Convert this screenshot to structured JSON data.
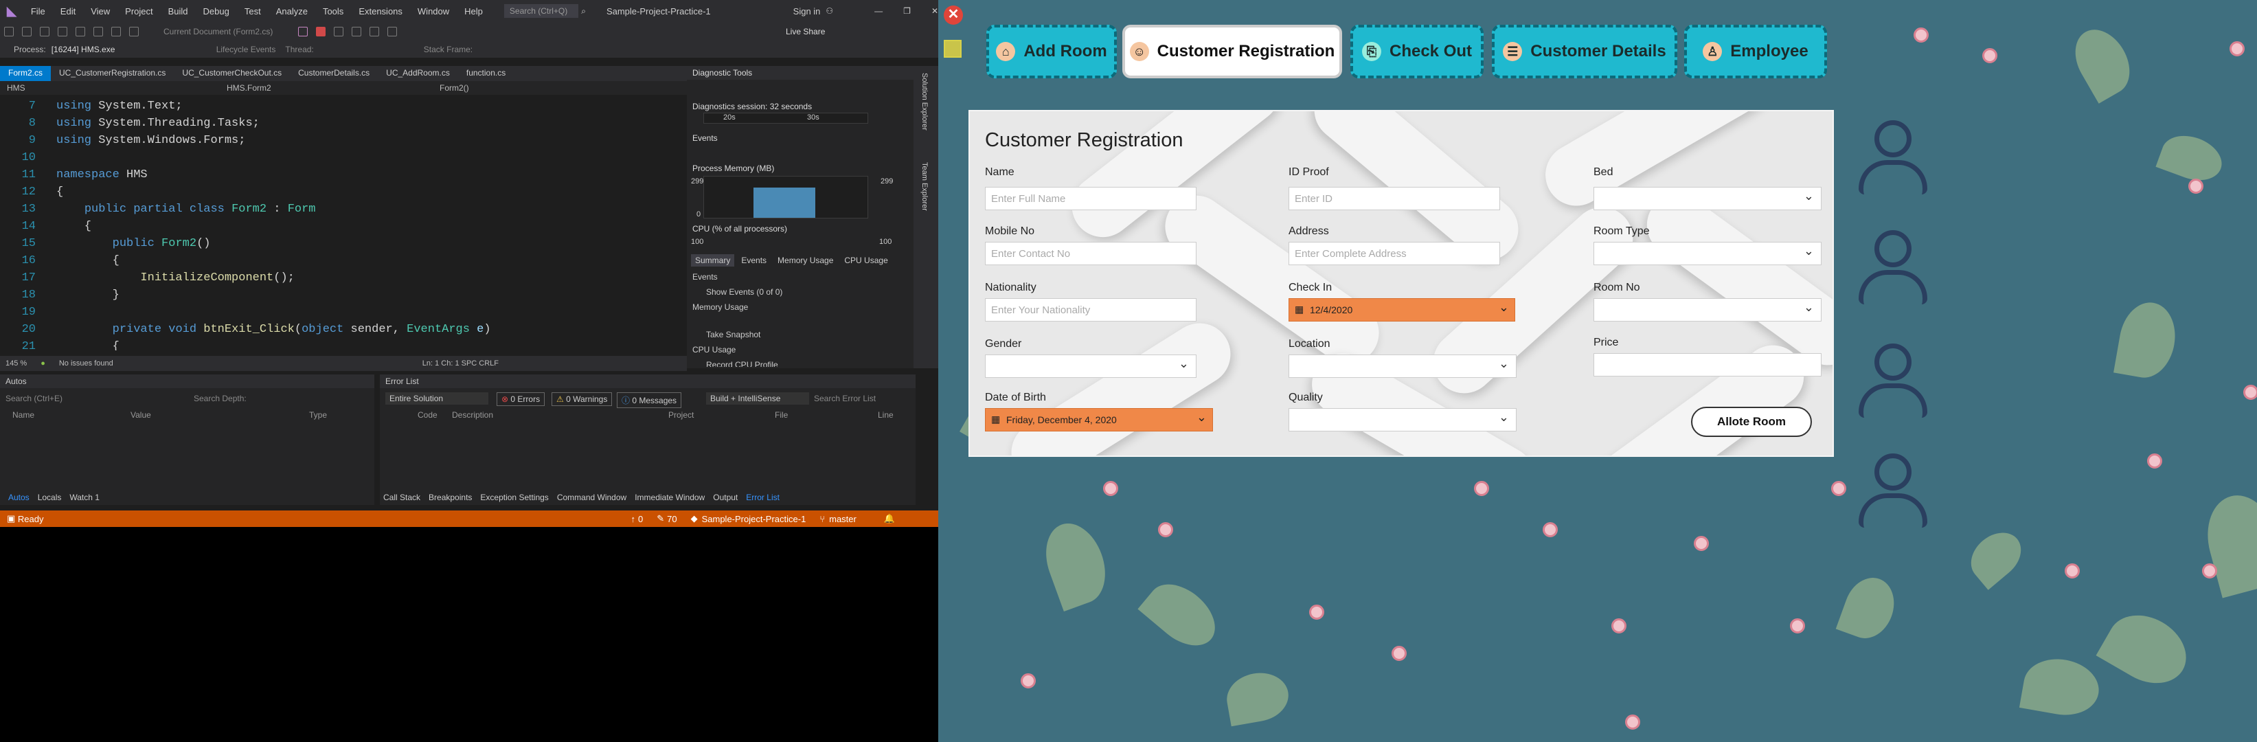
{
  "vs": {
    "menu": [
      "File",
      "Edit",
      "View",
      "Project",
      "Build",
      "Debug",
      "Test",
      "Analyze",
      "Tools",
      "Extensions",
      "Window",
      "Help"
    ],
    "search_placeholder": "Search (Ctrl+Q)",
    "solution_title": "Sample-Project-Practice-1",
    "sign_in": "Sign in",
    "live_share": "Live Share",
    "current_doc": "Current Document (Form2.cs)",
    "process_label": "Process:",
    "process_value": "[16244] HMS.exe",
    "lifecycle": "Lifecycle Events",
    "thread": "Thread:",
    "stack_frame": "Stack Frame:",
    "tabs": [
      "Form2.cs",
      "UC_CustomerRegistration.cs",
      "UC_CustomerCheckOut.cs",
      "CustomerDetails.cs",
      "UC_AddRoom.cs",
      "function.cs"
    ],
    "nav": {
      "project": "HMS",
      "class": "HMS.Form2",
      "member": "Form2()"
    },
    "code_lines": [
      {
        "n": "7",
        "t": "using System.Text;"
      },
      {
        "n": "8",
        "t": "using System.Threading.Tasks;"
      },
      {
        "n": "9",
        "t": "using System.Windows.Forms;"
      },
      {
        "n": "10",
        "t": ""
      },
      {
        "n": "11",
        "t": "namespace HMS"
      },
      {
        "n": "12",
        "t": "{"
      },
      {
        "n": "13",
        "t": "    public partial class Form2 : Form"
      },
      {
        "n": "14",
        "t": "    {"
      },
      {
        "n": "15",
        "t": "        public Form2()"
      },
      {
        "n": "16",
        "t": "        {"
      },
      {
        "n": "17",
        "t": "            InitializeComponent();"
      },
      {
        "n": "18",
        "t": "        }"
      },
      {
        "n": "19",
        "t": ""
      },
      {
        "n": "20",
        "t": "        private void btnExit_Click(object sender, EventArgs e)"
      },
      {
        "n": "21",
        "t": "        {"
      }
    ],
    "zoom": "145 %",
    "issues": "No issues found",
    "ln_col": "Ln: 1   Ch: 1   SPC   CRLF",
    "diag": {
      "title": "Diagnostic Tools",
      "session": "Diagnostics session: 32 seconds",
      "t20": "20s",
      "t30": "30s",
      "events": "Events",
      "memory": "Process Memory (MB)",
      "mem_max": "299",
      "mem_min": "0",
      "cpu": "CPU (% of all processors)",
      "cpu_max": "100",
      "tabs": [
        "Summary",
        "Events",
        "Memory Usage",
        "CPU Usage"
      ],
      "ev_head": "Events",
      "show_events": "Show Events (0 of 0)",
      "mem_head": "Memory Usage",
      "take_snapshot": "Take Snapshot",
      "cpu_head": "CPU Usage",
      "record_cpu": "Record CPU Profile"
    },
    "autos": {
      "title": "Autos",
      "search": "Search (Ctrl+E)",
      "depth": "Search Depth:",
      "cols": [
        "Name",
        "Value",
        "Type"
      ]
    },
    "errors": {
      "title": "Error List",
      "scope": "Entire Solution",
      "err": "0 Errors",
      "warn": "0 Warnings",
      "msg": "0 Messages",
      "build": "Build + IntelliSense",
      "search": "Search Error List",
      "cols": [
        "Code",
        "Description",
        "Project",
        "File",
        "Line"
      ]
    },
    "bottom_left_tabs": [
      "Autos",
      "Locals",
      "Watch 1"
    ],
    "bottom_right_tabs": [
      "Call Stack",
      "Breakpoints",
      "Exception Settings",
      "Command Window",
      "Immediate Window",
      "Output",
      "Error List"
    ],
    "status": {
      "ready": "Ready",
      "up": "0",
      "edits": "70",
      "project": "Sample-Project-Practice-1",
      "branch": "master"
    },
    "side_tabs": [
      "Solution Explorer",
      "Team Explorer"
    ]
  },
  "app": {
    "nav": [
      {
        "label": "Add Room",
        "icon": "room-icon"
      },
      {
        "label": "Customer Registration",
        "icon": "customer-icon"
      },
      {
        "label": "Check Out",
        "icon": "checkout-icon"
      },
      {
        "label": "Customer Details",
        "icon": "details-icon"
      },
      {
        "label": "Employee",
        "icon": "employee-icon"
      }
    ],
    "heading": "Customer Registration",
    "fields": {
      "name_label": "Name",
      "name_ph": "Enter Full Name",
      "idproof_label": "ID Proof",
      "idproof_ph": "Enter ID",
      "bed_label": "Bed",
      "mobile_label": "Mobile No",
      "mobile_ph": "Enter Contact No",
      "address_label": "Address",
      "address_ph": "Enter Complete Address",
      "roomtype_label": "Room Type",
      "nationality_label": "Nationality",
      "nationality_ph": "Enter Your Nationality",
      "checkin_label": "Check In",
      "checkin_value": "12/4/2020",
      "roomno_label": "Room No",
      "gender_label": "Gender",
      "location_label": "Location",
      "price_label": "Price",
      "dob_label": "Date of Birth",
      "dob_value": "Friday,  December  4, 2020",
      "quality_label": "Quality"
    },
    "allot": "Allote Room",
    "colors": {
      "bg": "#3f6f7f",
      "nav": "#1fb9cf",
      "date": "#f08848"
    }
  }
}
